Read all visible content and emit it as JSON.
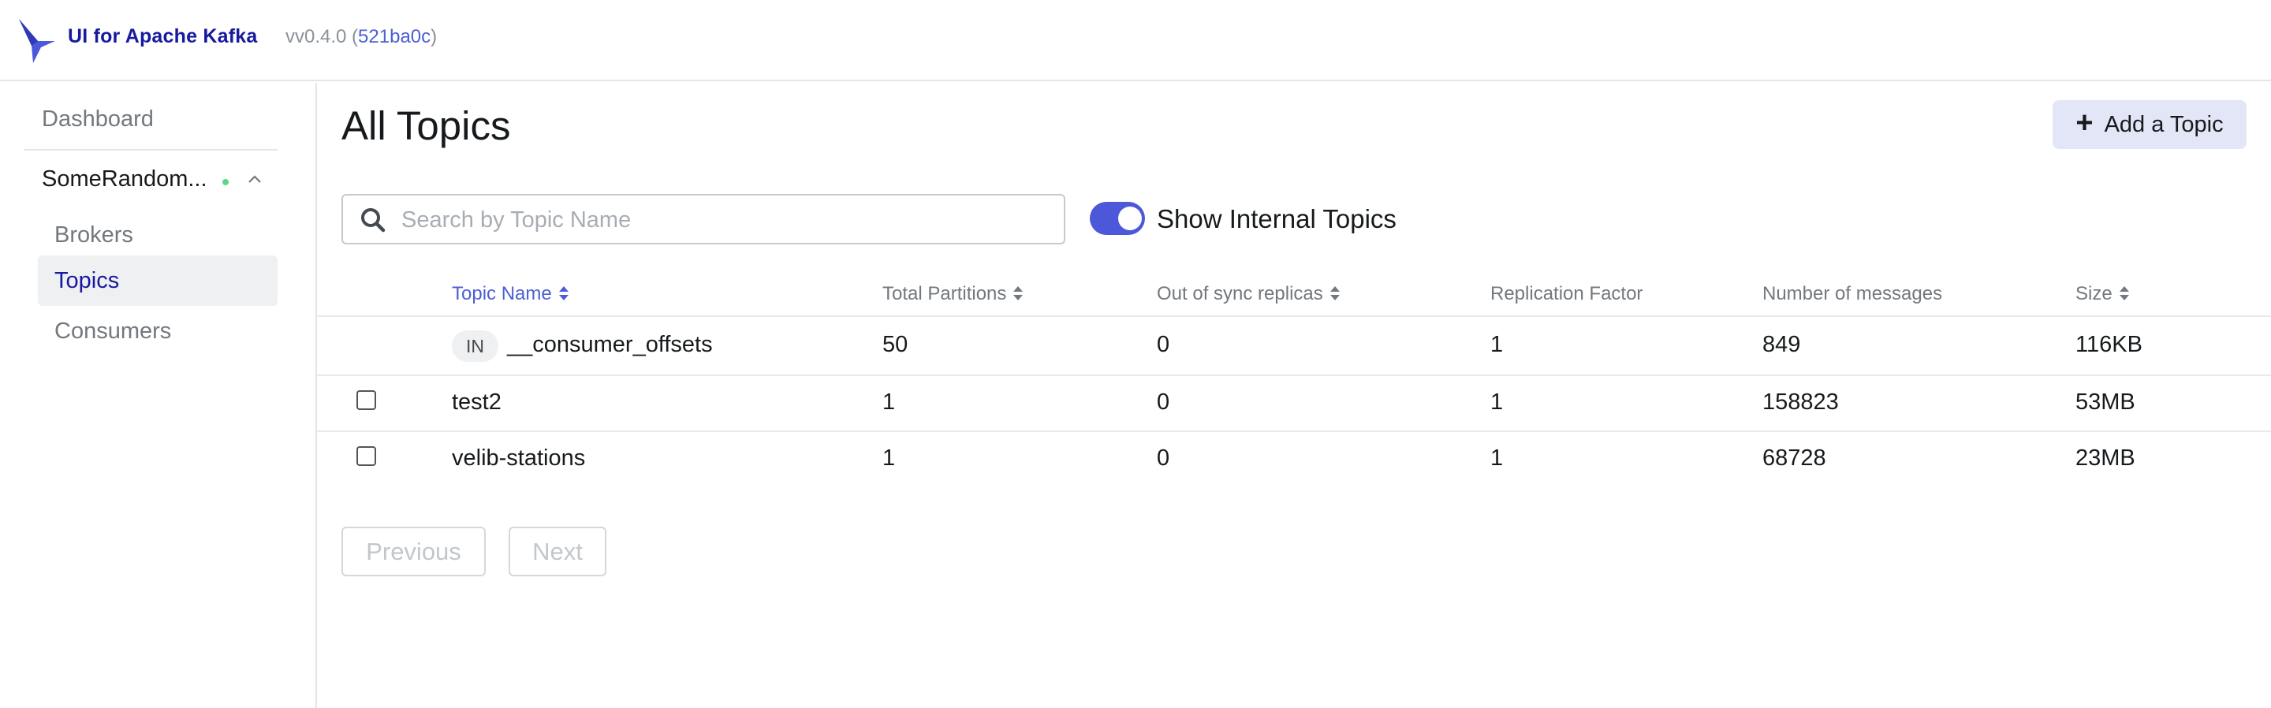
{
  "header": {
    "brand": "UI for Apache Kafka",
    "version_prefix": "vv0.4.0 (",
    "version_hash": "521ba0c",
    "version_suffix": ")",
    "brand_color": "#171a9f"
  },
  "sidebar": {
    "dashboard": "Dashboard",
    "cluster_name": "SomeRandom...",
    "cluster_status": "online",
    "items": [
      {
        "label": "Brokers",
        "active": false
      },
      {
        "label": "Topics",
        "active": true
      },
      {
        "label": "Consumers",
        "active": false
      }
    ]
  },
  "main": {
    "title": "All Topics",
    "add_button": "Add a Topic",
    "search_placeholder": "Search by Topic Name",
    "search_value": "",
    "toggle_label": "Show Internal Topics",
    "toggle_on": true
  },
  "table": {
    "columns": [
      "Topic Name",
      "Total Partitions",
      "Out of sync replicas",
      "Replication Factor",
      "Number of messages",
      "Size"
    ],
    "rows": [
      {
        "internal_badge": "IN",
        "name": "__consumer_offsets",
        "partitions": "50",
        "out_of_sync": "0",
        "replication": "1",
        "messages": "849",
        "size": "116KB"
      },
      {
        "internal_badge": "",
        "name": "test2",
        "partitions": "1",
        "out_of_sync": "0",
        "replication": "1",
        "messages": "158823",
        "size": "53MB"
      },
      {
        "internal_badge": "",
        "name": "velib-stations",
        "partitions": "1",
        "out_of_sync": "0",
        "replication": "1",
        "messages": "68728",
        "size": "23MB"
      }
    ]
  },
  "pagination": {
    "previous": "Previous",
    "next": "Next"
  },
  "colors": {
    "accent": "#4c58d9",
    "status_online": "#5cd685",
    "active_nav_bg": "#eef0f2"
  }
}
